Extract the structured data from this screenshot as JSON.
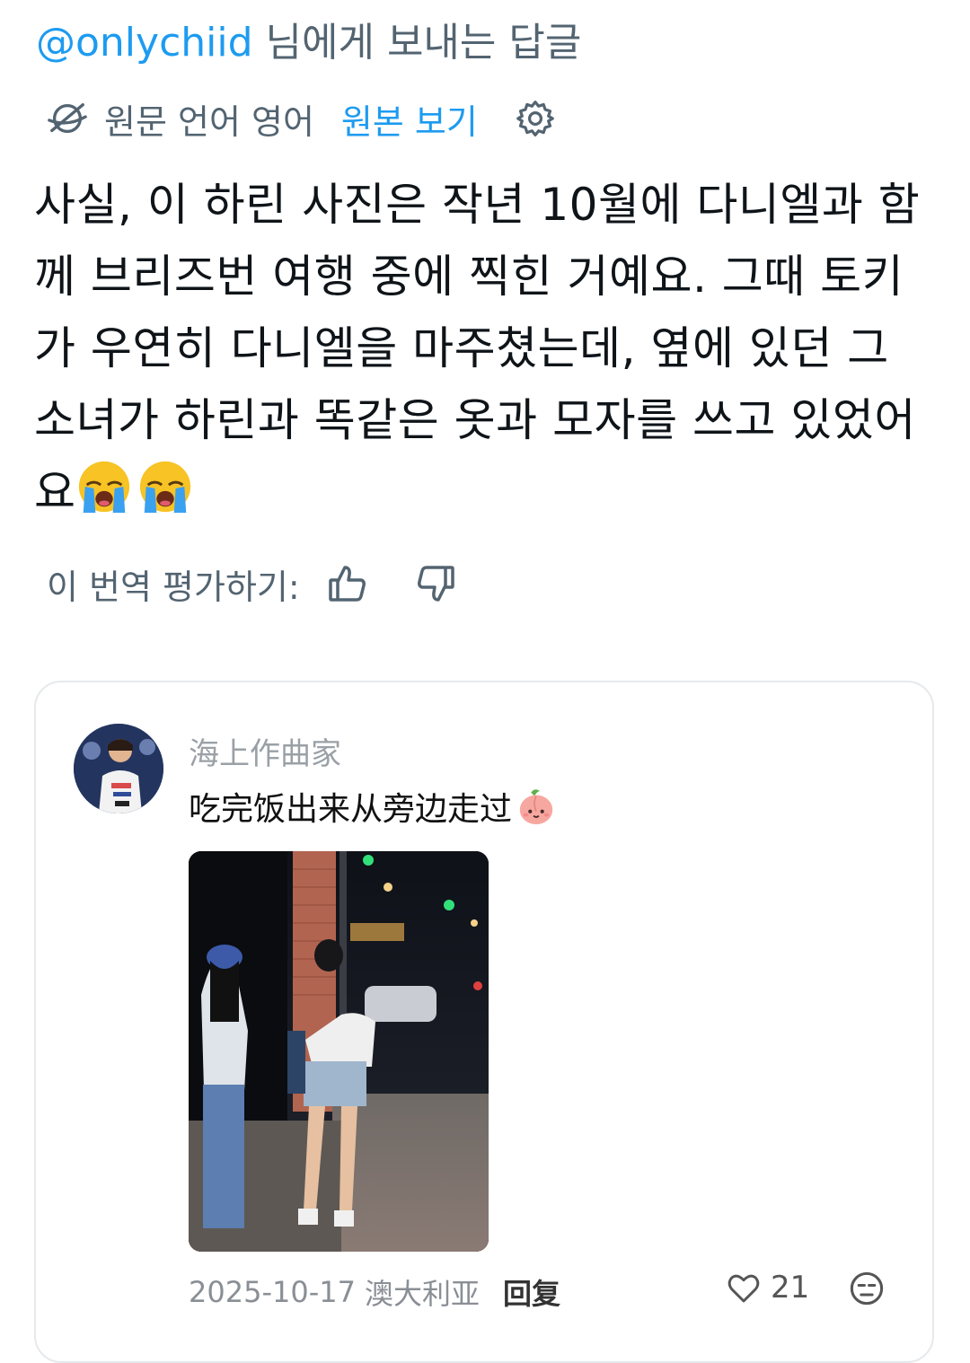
{
  "reply_header": {
    "handle": "@onlychiid",
    "suffix": " 님에게 보내는 답글"
  },
  "translation_bar": {
    "globe_icon": "translate-globe-icon",
    "source_language": "원문 언어 영어",
    "show_original_label": "원본 보기",
    "settings_icon": "gear-icon"
  },
  "tweet": {
    "text": "사실, 이 하린 사진은 작년 10월에 다니엘과 함께 브리즈번 여행 중에 찍힌 거예요. 그때 토키가 우연히 다니엘을 마주쳤는데, 옆에 있던 그 소녀가 하린과 똑같은 옷과 모자를 쓰고 있었어요",
    "emojis": [
      "loudly-crying-face",
      "loudly-crying-face"
    ]
  },
  "rating": {
    "label": "이 번역 평가하기:",
    "thumbs_up_icon": "thumbs-up-icon",
    "thumbs_down_icon": "thumbs-down-icon"
  },
  "embedded_comment": {
    "author": "海上作曲家",
    "text": "吃完饭出来从旁边走过",
    "emoji": "peach-face-sticker",
    "date": "2025-10-17",
    "location": "澳大利亚",
    "reply_label": "回复",
    "like_count": "21"
  },
  "colors": {
    "accent": "#1d9bf0",
    "secondary_text": "#536471",
    "card_border": "#e6e9ec"
  }
}
